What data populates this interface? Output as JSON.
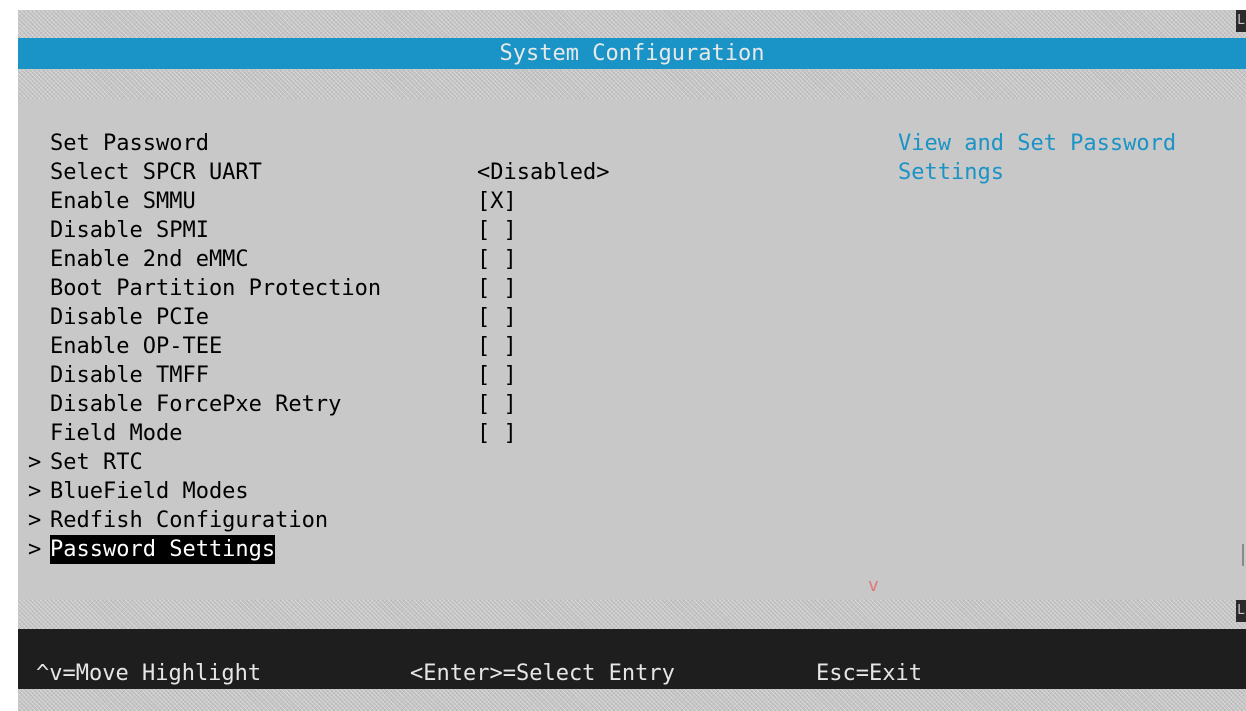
{
  "title": "System Configuration",
  "menu_items": [
    {
      "label": "Set Password",
      "value": "",
      "submenu": false
    },
    {
      "label": "Select SPCR UART",
      "value": "<Disabled>",
      "submenu": false
    },
    {
      "label": "Enable SMMU",
      "value": "[X]",
      "submenu": false
    },
    {
      "label": "Disable SPMI",
      "value": "[ ]",
      "submenu": false
    },
    {
      "label": "Enable 2nd eMMC",
      "value": "[ ]",
      "submenu": false
    },
    {
      "label": "Boot Partition Protection",
      "value": "[ ]",
      "submenu": false
    },
    {
      "label": "Disable PCIe",
      "value": "[ ]",
      "submenu": false
    },
    {
      "label": "Enable OP-TEE",
      "value": "[ ]",
      "submenu": false
    },
    {
      "label": "Disable TMFF",
      "value": "[ ]",
      "submenu": false
    },
    {
      "label": "Disable ForcePxe Retry",
      "value": "[ ]",
      "submenu": false
    },
    {
      "label": "Field Mode",
      "value": "[ ]",
      "submenu": false
    },
    {
      "label": "Set RTC",
      "value": "",
      "submenu": true,
      "arrow": ">"
    },
    {
      "label": "BlueField Modes",
      "value": "",
      "submenu": true,
      "arrow": ">"
    },
    {
      "label": "Redfish Configuration",
      "value": "",
      "submenu": true,
      "arrow": ">"
    },
    {
      "label": "Password Settings",
      "value": "",
      "submenu": true,
      "arrow": ">",
      "highlighted": true
    }
  ],
  "help_text": "View and Set Password\nSettings",
  "scroll_indicator": "v",
  "footer": {
    "move": "^v=Move Highlight",
    "select": "<Enter>=Select Entry",
    "exit": "Esc=Exit"
  },
  "colors": {
    "title_bar": "#1a93c6",
    "background": "#c8c8c8",
    "highlight": "#000000",
    "help_text": "#1a93c6",
    "footer": "#1e1e1e"
  }
}
